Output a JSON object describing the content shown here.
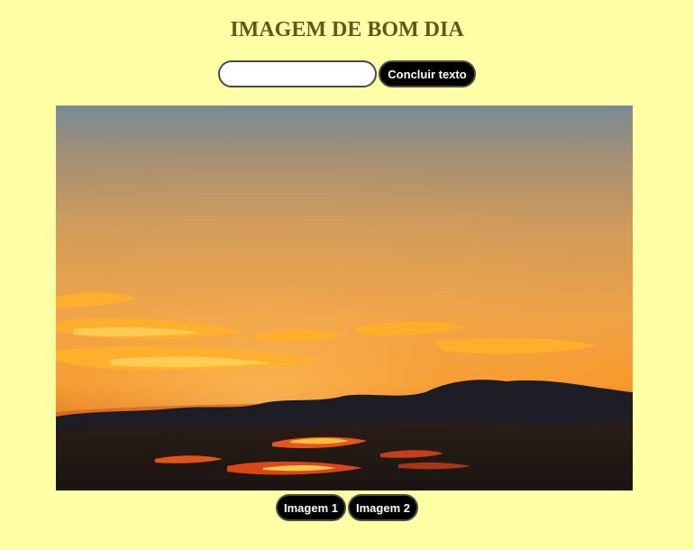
{
  "page": {
    "title": "IMAGEM DE BOM DIA"
  },
  "form": {
    "text_input_value": "",
    "text_input_placeholder": "",
    "submit_label": "Concluir texto"
  },
  "image_switcher": {
    "buttons": [
      {
        "label": "Imagem 1"
      },
      {
        "label": "Imagem 2"
      }
    ]
  },
  "theme": {
    "background": "#ffffa6",
    "title_color": "#5f5a1a",
    "button_background": "#000000",
    "button_text": "#ffffff"
  }
}
